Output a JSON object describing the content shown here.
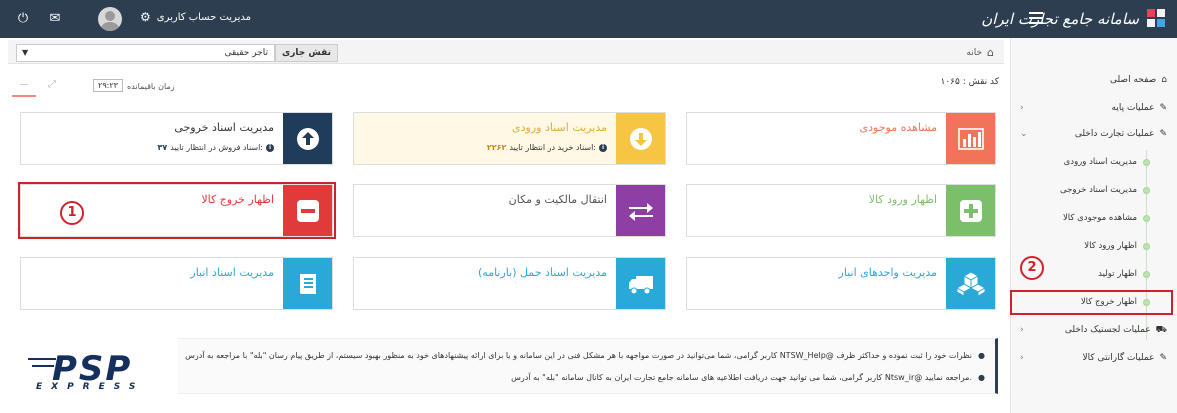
{
  "app": {
    "title": "سامانه جامع تجارت ایران",
    "account_label": "مدیریت حساب کاربری"
  },
  "header": {
    "breadcrumb_home": "خانه",
    "role_label": "نقش جاری",
    "role_value": "تاجر حقیقی",
    "code_label": "کد نقش :",
    "code_value": "۱۰۶۵",
    "timer_label": "زمان باقیمانده",
    "timer_value": "۲۹:۲۳"
  },
  "tiles": [
    {
      "id": "outgoing",
      "title": "مدیریت اسناد خروجی",
      "sub": "اسناد فروش در انتظار تایید:",
      "sub_value": "۳۷",
      "color": "#1f3c5a",
      "icon": "arrow-up-circle-icon"
    },
    {
      "id": "incoming",
      "title": "مدیریت اسناد ورودی",
      "sub": "اسناد خرید در انتظار تایید:",
      "sub_value": "۲۲۶۲",
      "color": "#f6c544",
      "icon": "arrow-down-circle-icon"
    },
    {
      "id": "inventory",
      "title": "مشاهده موجودی",
      "color": "#f0735a",
      "icon": "bar-chart-icon"
    },
    {
      "id": "exit",
      "title": "اظهار خروج کالا",
      "color": "#e03a3a",
      "icon": "minus-square-icon"
    },
    {
      "id": "transfer",
      "title": "انتقال مالکیت و مکان",
      "color": "#8e3fa3",
      "icon": "swap-arrows-icon"
    },
    {
      "id": "entry",
      "title": "اظهار ورود کالا",
      "color": "#7cbf6a",
      "icon": "plus-square-icon"
    },
    {
      "id": "warehouse-docs",
      "title": "مدیریت اسناد انبار",
      "color": "#2aa8d8",
      "icon": "book-icon"
    },
    {
      "id": "transport",
      "title": "مدیریت اسناد حمل (بارنامه)",
      "color": "#2aa8d8",
      "icon": "truck-icon"
    },
    {
      "id": "warehouse-units",
      "title": "مدیریت واحدهای انبار",
      "color": "#2aa8d8",
      "icon": "cubes-icon"
    }
  ],
  "sidebar": {
    "items": [
      {
        "label": "صفحه اصلی",
        "icon": "home-icon"
      },
      {
        "label": "عملیات پایه",
        "icon": "edit-icon"
      },
      {
        "label": "عملیات تجارت داخلی",
        "icon": "edit-icon"
      },
      {
        "label": "عملیات لجستیک داخلی",
        "icon": "truck-icon"
      },
      {
        "label": "عملیات گارانتی کالا",
        "icon": "edit-icon"
      }
    ],
    "sub_items": [
      "مدیریت اسناد ورودی",
      "مدیریت اسناد خروجی",
      "مشاهده موجودی کالا",
      "اظهار ورود کالا",
      "اظهار تولید",
      "اظهار خروج کالا"
    ]
  },
  "annotations": {
    "tile_marker": "1",
    "menu_marker": "2"
  },
  "notice": {
    "line1": "کاربر گرامی، شما می‌توانید در صورت مواجهه با هر مشکل فنی در این سامانه و یا برای ارائه پیشنهادهای خود به منظور بهبود سیستم، از طریق پیام رسان \"بله\" با مراجعه به آدرس NTSW_Help@ نظرات خود را ثبت نموده و حداکثر ظرف",
    "line2": "کاربر گرامی، شما می توانید جهت دریافت اطلاعیه های سامانه جامع تجارت ایران به کانال سامانه \"بله\" به آدرس Ntsw_ir@ مراجعه نمایید."
  },
  "watermark": {
    "brand": "PSP",
    "sub": "EXPRESS"
  },
  "colors": {
    "topbar": "#2c3e50",
    "highlight": "#d0202a"
  }
}
